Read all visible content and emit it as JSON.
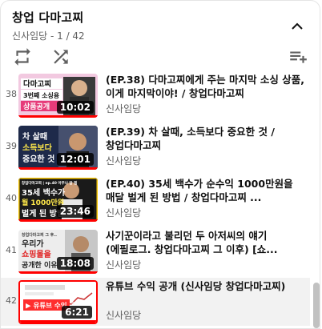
{
  "playlist": {
    "title": "창업 다마고찌",
    "subtitle": "신사임당 - 1 / 42",
    "icons": {
      "collapse": "chevron-up-icon",
      "loop": "loop-icon",
      "shuffle": "shuffle-icon",
      "save": "playlist-add-icon"
    }
  },
  "items": [
    {
      "index": "38",
      "title": "(EP.38) 다마고찌에게 주는 마지막 소싱 상품, 이게 마지막이야! / 창업다마고찌",
      "channel": "신사임당",
      "duration": "10:02",
      "thumb_text": [
        "다마고찌",
        "3번째 소싱용",
        "상품공개"
      ]
    },
    {
      "index": "39",
      "title": "(EP.39) 차 살때, 소득보다 중요한 것 / 창업다마고찌",
      "channel": "신사임당",
      "duration": "12:01",
      "thumb_text": [
        "차 살때",
        "소득보다",
        "중요한 것"
      ]
    },
    {
      "index": "40",
      "title": "(EP.40) 35세 백수가 순수익 1000만원을 매달 벌게 된 방법 / 창업다마고찌 ...",
      "channel": "신사임당",
      "duration": "23:46",
      "thumb_text": [
        "창업다마고찌 | ep.40 아무나 맘 필",
        "35세 백수가",
        "월 1000만원",
        "벌게 된 방법"
      ]
    },
    {
      "index": "41",
      "title": "사기꾼이라고 불리던 두 아저씨의 얘기 (에필로그. 창업다마고찌 그 이후) [쇼...",
      "channel": "신사임당",
      "duration": "18:08",
      "thumb_text": [
        "창업다마고찌 그 후..",
        "우리가",
        "쇼핑몰을",
        "공개한 이유"
      ]
    },
    {
      "index": "42",
      "title": "유튜브 수익 공개 (신사임당 창업다마고찌)",
      "channel": "신사임당",
      "duration": "6:21",
      "thumb_text": [
        "▶ 유튜브 수익 공개"
      ]
    }
  ],
  "colors": {
    "accent": "#ff0000",
    "thumb38": "#f2c9e0",
    "thumb39": "#1e2a4a",
    "thumb40": "#1a1a1a",
    "thumb41": "#ededed",
    "thumb42": "#ffffff"
  }
}
